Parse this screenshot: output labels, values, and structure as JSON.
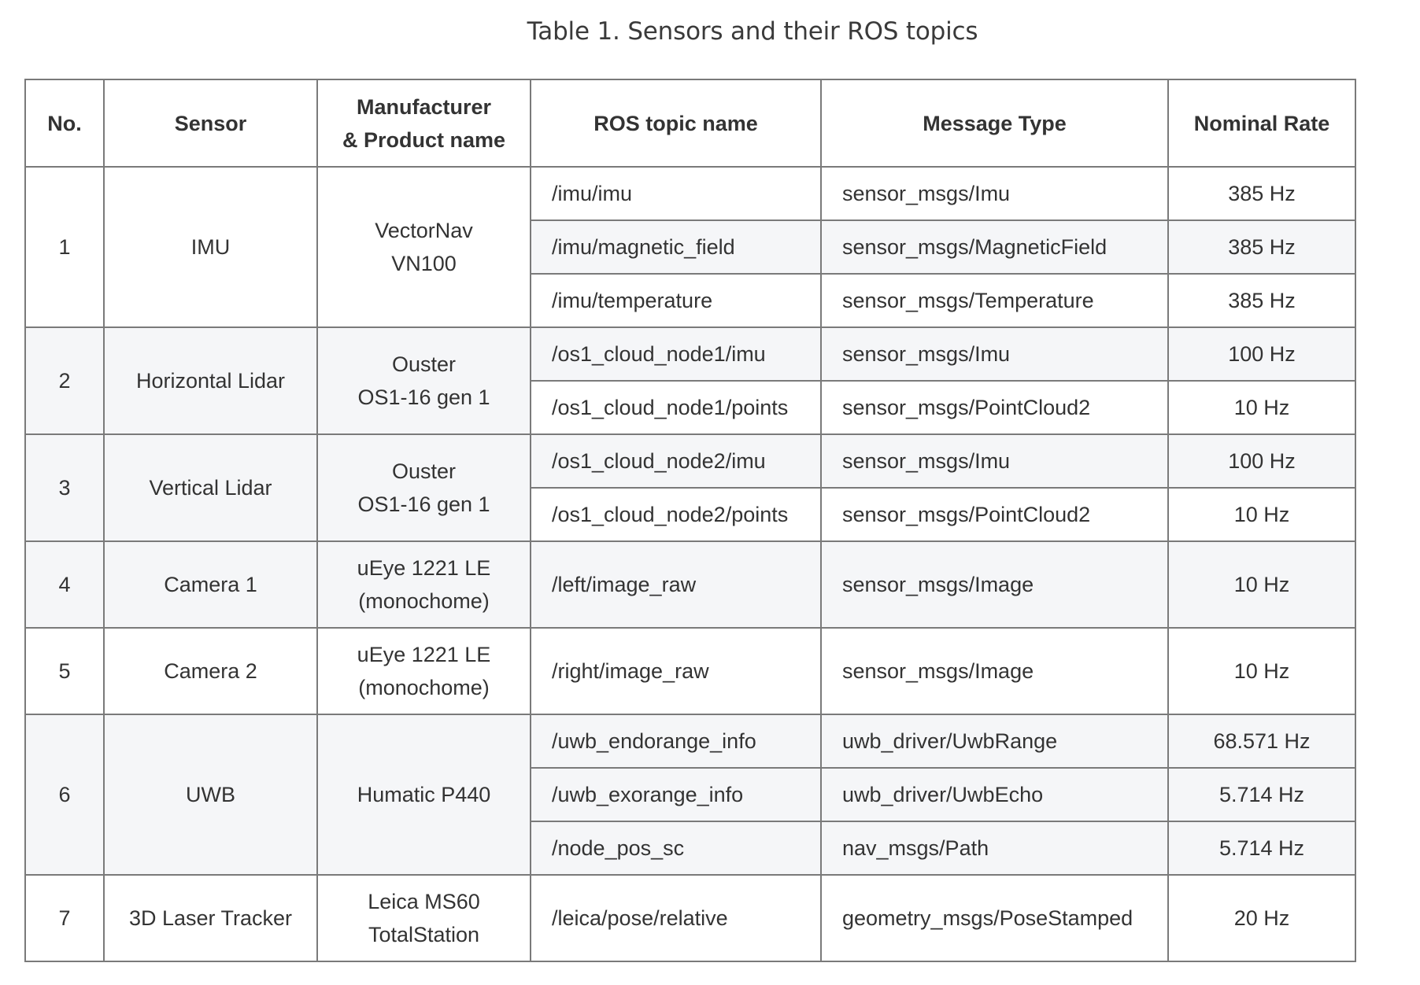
{
  "caption": "Table 1. Sensors and their ROS topics",
  "headers": {
    "no": "No.",
    "sensor": "Sensor",
    "manufacturer": "Manufacturer\n& Product name",
    "topic": "ROS topic name",
    "message_type": "Message Type",
    "rate": "Nominal Rate"
  },
  "groups": [
    {
      "no": "1",
      "sensor": "IMU",
      "product": "VectorNav\nVN100",
      "topics": [
        {
          "topic": "/imu/imu",
          "type": "sensor_msgs/Imu",
          "rate": "385 Hz"
        },
        {
          "topic": "/imu/magnetic_field",
          "type": "sensor_msgs/MagneticField",
          "rate": "385 Hz"
        },
        {
          "topic": "/imu/temperature",
          "type": "sensor_msgs/Temperature",
          "rate": "385 Hz"
        }
      ]
    },
    {
      "no": "2",
      "sensor": "Horizontal Lidar",
      "product": "Ouster\nOS1-16 gen 1",
      "topics": [
        {
          "topic": "/os1_cloud_node1/imu",
          "type": "sensor_msgs/Imu",
          "rate": "100 Hz"
        },
        {
          "topic": "/os1_cloud_node1/points",
          "type": "sensor_msgs/PointCloud2",
          "rate": "10 Hz"
        }
      ]
    },
    {
      "no": "3",
      "sensor": "Vertical Lidar",
      "product": "Ouster\nOS1-16 gen 1",
      "topics": [
        {
          "topic": "/os1_cloud_node2/imu",
          "type": "sensor_msgs/Imu",
          "rate": "100 Hz"
        },
        {
          "topic": "/os1_cloud_node2/points",
          "type": "sensor_msgs/PointCloud2",
          "rate": "10 Hz"
        }
      ]
    },
    {
      "no": "4",
      "sensor": "Camera 1",
      "product": "uEye 1221 LE\n(monochome)",
      "topics": [
        {
          "topic": "/left/image_raw",
          "type": "sensor_msgs/Image",
          "rate": "10 Hz"
        }
      ]
    },
    {
      "no": "5",
      "sensor": "Camera 2",
      "product": "uEye 1221 LE\n(monochome)",
      "topics": [
        {
          "topic": "/right/image_raw",
          "type": "sensor_msgs/Image",
          "rate": "10 Hz"
        }
      ]
    },
    {
      "no": "6",
      "sensor": "UWB",
      "product": "Humatic P440",
      "topics": [
        {
          "topic": "/uwb_endorange_info",
          "type": "uwb_driver/UwbRange",
          "rate": "68.571 Hz"
        },
        {
          "topic": "/uwb_exorange_info",
          "type": "uwb_driver/UwbEcho",
          "rate": "5.714 Hz"
        },
        {
          "topic": "/node_pos_sc",
          "type": "nav_msgs/Path",
          "rate": "5.714 Hz"
        }
      ]
    },
    {
      "no": "7",
      "sensor": "3D Laser Tracker",
      "product": "Leica MS60\nTotalStation",
      "topics": [
        {
          "topic": "/leica/pose/relative",
          "type": "geometry_msgs/PoseStamped",
          "rate": "20 Hz"
        }
      ]
    }
  ]
}
